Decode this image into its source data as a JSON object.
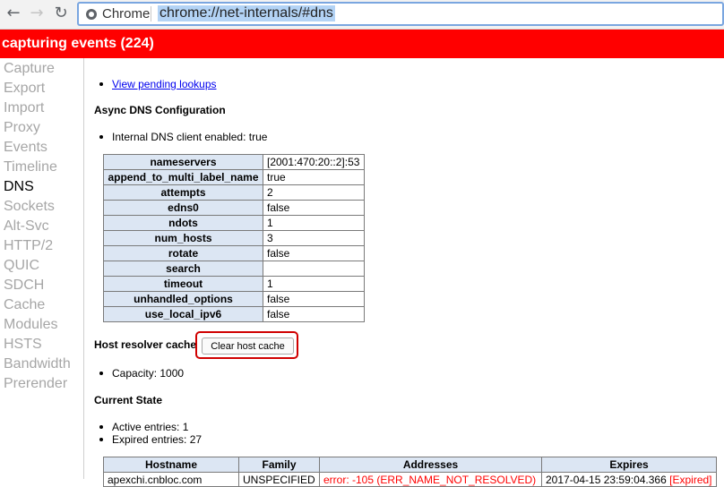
{
  "browser": {
    "back_glyph": "←",
    "forward_glyph": "→",
    "reload_glyph": "↻",
    "chrome_label": "Chrome",
    "url": "chrome://net-internals/#dns"
  },
  "status_bar": {
    "text": "capturing events (224)"
  },
  "sidebar": {
    "items": [
      {
        "label": "Capture"
      },
      {
        "label": "Export"
      },
      {
        "label": "Import"
      },
      {
        "label": "Proxy"
      },
      {
        "label": "Events"
      },
      {
        "label": "Timeline"
      },
      {
        "label": "DNS"
      },
      {
        "label": "Sockets"
      },
      {
        "label": "Alt-Svc"
      },
      {
        "label": "HTTP/2"
      },
      {
        "label": "QUIC"
      },
      {
        "label": "SDCH"
      },
      {
        "label": "Cache"
      },
      {
        "label": "Modules"
      },
      {
        "label": "HSTS"
      },
      {
        "label": "Bandwidth"
      },
      {
        "label": "Prerender"
      }
    ],
    "active": "DNS"
  },
  "main": {
    "pending_link": "View pending lookups",
    "async_heading": "Async DNS Configuration",
    "internal_client": "Internal DNS client enabled: true",
    "config_rows": [
      {
        "key": "nameservers",
        "value": "[2001:470:20::2]:53"
      },
      {
        "key": "append_to_multi_label_name",
        "value": "true"
      },
      {
        "key": "attempts",
        "value": "2"
      },
      {
        "key": "edns0",
        "value": "false"
      },
      {
        "key": "ndots",
        "value": "1"
      },
      {
        "key": "num_hosts",
        "value": "3"
      },
      {
        "key": "rotate",
        "value": "false"
      },
      {
        "key": "search",
        "value": ""
      },
      {
        "key": "timeout",
        "value": "1"
      },
      {
        "key": "unhandled_options",
        "value": "false"
      },
      {
        "key": "use_local_ipv6",
        "value": "false"
      }
    ],
    "host_cache_heading": "Host resolver cache",
    "clear_button": "Clear host cache",
    "capacity": "Capacity: 1000",
    "current_state_heading": "Current State",
    "active_entries": "Active entries: 1",
    "expired_entries": "Expired entries: 27",
    "entries_table": {
      "headers": [
        "Hostname",
        "Family",
        "Addresses",
        "Expires"
      ],
      "rows": [
        {
          "hostname": "apexchi.cnbloc.com",
          "family": "UNSPECIFIED",
          "addresses": "error: -105 (ERR_NAME_NOT_RESOLVED)",
          "expires": "2017-04-15 23:59:04.366",
          "expired_tag": "[Expired]"
        }
      ]
    }
  },
  "colors": {
    "status_red": "#ff0000",
    "highlight_box": "#d00000",
    "table_header_bg": "#dce6f3",
    "link": "#0000ee",
    "sidebar_inactive": "#a6a6a6"
  }
}
